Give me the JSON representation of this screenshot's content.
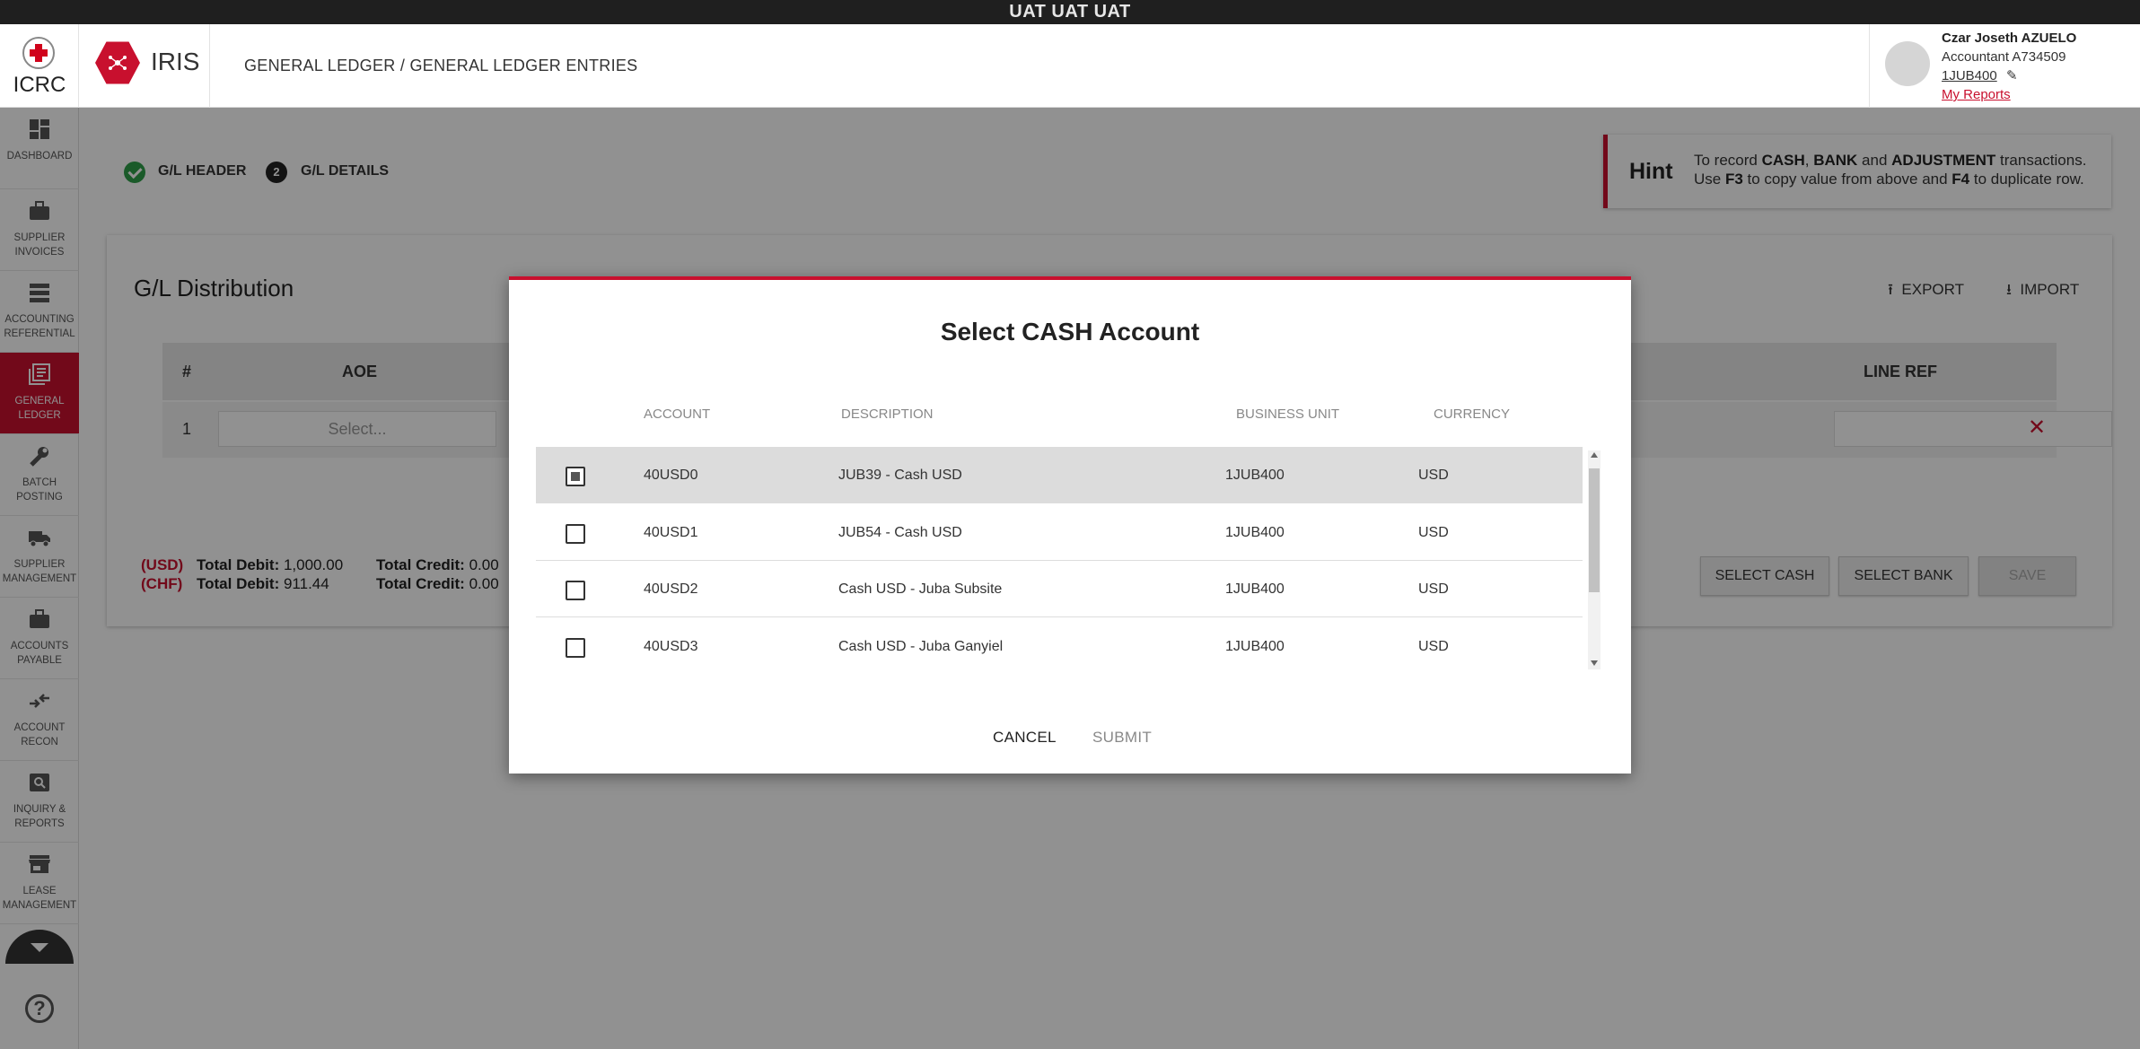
{
  "env_banner": "UAT UAT UAT",
  "header": {
    "org": "ICRC",
    "app": "IRIS",
    "breadcrumb": "GENERAL LEDGER / GENERAL LEDGER ENTRIES",
    "user": {
      "name": "Czar Joseth AZUELO",
      "role": "Accountant A734509",
      "business_unit": "1JUB400",
      "reports_link": "My Reports"
    }
  },
  "sidebar": {
    "items": [
      {
        "label": "DASHBOARD",
        "icon": "dashboard-icon"
      },
      {
        "label": "SUPPLIER INVOICES",
        "icon": "briefcase-icon"
      },
      {
        "label": "ACCOUNTING REFERENTIAL",
        "icon": "storage-icon"
      },
      {
        "label": "GENERAL LEDGER",
        "icon": "ledger-icon",
        "active": true
      },
      {
        "label": "BATCH POSTING",
        "icon": "wrench-icon"
      },
      {
        "label": "SUPPLIER MANAGEMENT",
        "icon": "truck-icon"
      },
      {
        "label": "ACCOUNTS PAYABLE",
        "icon": "briefcase-icon"
      },
      {
        "label": "ACCOUNT RECON",
        "icon": "compare-arrows-icon"
      },
      {
        "label": "INQUIRY & REPORTS",
        "icon": "search-icon"
      },
      {
        "label": "LEASE MANAGEMENT",
        "icon": "store-icon"
      }
    ],
    "help": "?"
  },
  "steps": [
    {
      "num": "",
      "label": "G/L HEADER",
      "state": "done"
    },
    {
      "num": "2",
      "label": "G/L DETAILS",
      "state": "current"
    }
  ],
  "hint": {
    "title": "Hint",
    "line1_parts": [
      "To record ",
      "CASH",
      ", ",
      "BANK",
      " and ",
      "ADJUSTMENT",
      " transactions."
    ],
    "line2_parts": [
      "Use ",
      "F3",
      " to copy value from above and ",
      "F4",
      " to duplicate row."
    ]
  },
  "distribution": {
    "title": "G/L Distribution",
    "export_label": "EXPORT",
    "import_label": "IMPORT",
    "columns": {
      "num": "#",
      "aoe": "AOE",
      "line_ref": "LINE REF"
    },
    "row": {
      "num": "1",
      "aoe_placeholder": "Select..."
    },
    "totals": [
      {
        "currency": "(USD)",
        "debit_label": "Total Debit:",
        "debit": "1,000.00",
        "credit_label": "Total Credit:",
        "credit": "0.00"
      },
      {
        "currency": "(CHF)",
        "debit_label": "Total Debit:",
        "debit": "911.44",
        "credit_label": "Total Credit:",
        "credit": "0.00"
      }
    ],
    "buttons": {
      "select_cash": "SELECT CASH",
      "select_bank": "SELECT BANK",
      "save": "SAVE"
    }
  },
  "modal": {
    "title": "Select CASH Account",
    "columns": {
      "account": "ACCOUNT",
      "description": "DESCRIPTION",
      "business_unit": "BUSINESS UNIT",
      "currency": "CURRENCY"
    },
    "rows": [
      {
        "account": "40USD0",
        "description": "JUB39 - Cash USD",
        "business_unit": "1JUB400",
        "currency": "USD",
        "checked": true
      },
      {
        "account": "40USD1",
        "description": "JUB54 - Cash USD",
        "business_unit": "1JUB400",
        "currency": "USD",
        "checked": false
      },
      {
        "account": "40USD2",
        "description": "Cash USD - Juba Subsite",
        "business_unit": "1JUB400",
        "currency": "USD",
        "checked": false
      },
      {
        "account": "40USD3",
        "description": "Cash USD - Juba Ganyiel",
        "business_unit": "1JUB400",
        "currency": "USD",
        "checked": false
      }
    ],
    "cancel_label": "CANCEL",
    "submit_label": "SUBMIT"
  },
  "colors": {
    "accent": "#c8102e",
    "success": "#2e9e48",
    "banner": "#1f1f1f"
  }
}
